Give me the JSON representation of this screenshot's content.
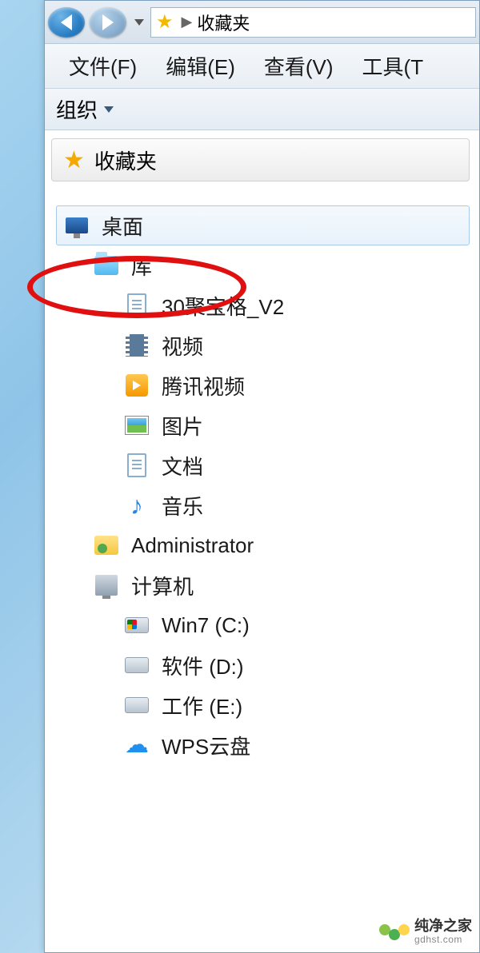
{
  "nav": {
    "breadcrumb_location": "收藏夹"
  },
  "menu": {
    "file": "文件(F)",
    "edit": "编辑(E)",
    "view": "查看(V)",
    "tools": "工具(T"
  },
  "toolbar": {
    "organize": "组织"
  },
  "sidebar": {
    "fav_header": "收藏夹",
    "items": [
      {
        "label": "桌面",
        "icon": "monitor",
        "depth": 0,
        "selected": true
      },
      {
        "label": "库",
        "icon": "folder-blue",
        "depth": 1
      },
      {
        "label": "30聚宝格_V2",
        "icon": "doc",
        "depth": 2
      },
      {
        "label": "视频",
        "icon": "film",
        "depth": 2
      },
      {
        "label": "腾讯视频",
        "icon": "tencent",
        "depth": 2
      },
      {
        "label": "图片",
        "icon": "pic",
        "depth": 2
      },
      {
        "label": "文档",
        "icon": "doc",
        "depth": 2
      },
      {
        "label": "音乐",
        "icon": "music",
        "depth": 2
      },
      {
        "label": "Administrator",
        "icon": "user",
        "depth": 1
      },
      {
        "label": "计算机",
        "icon": "pc",
        "depth": 1
      },
      {
        "label": "Win7 (C:)",
        "icon": "hdd-win",
        "depth": 2
      },
      {
        "label": "软件 (D:)",
        "icon": "hdd",
        "depth": 2
      },
      {
        "label": "工作 (E:)",
        "icon": "hdd",
        "depth": 2
      },
      {
        "label": "WPS云盘",
        "icon": "cloud",
        "depth": 2
      }
    ]
  },
  "watermark": {
    "brand": "纯净之家",
    "url": "gdhst.com"
  }
}
